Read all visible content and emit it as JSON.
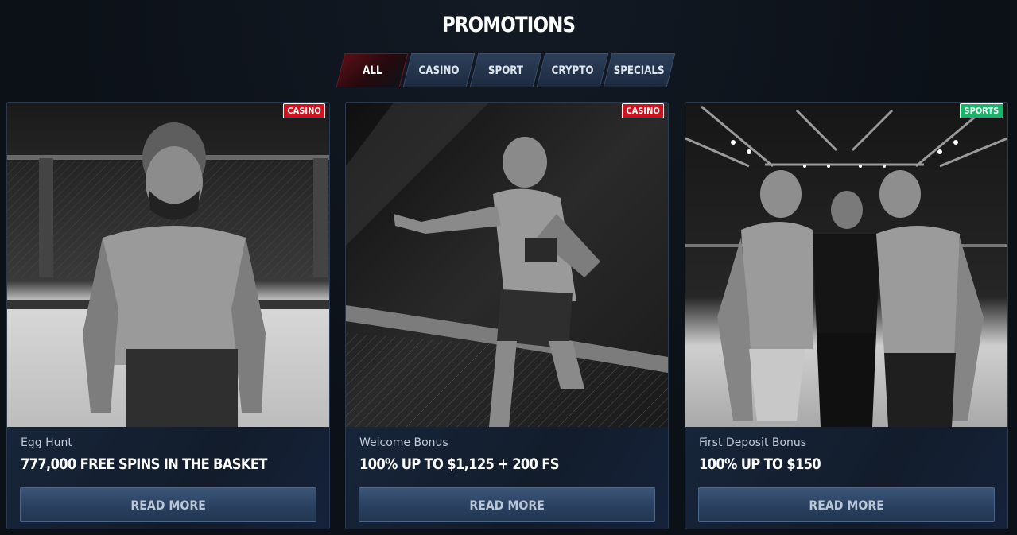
{
  "page": {
    "title": "PROMOTIONS"
  },
  "tabs": [
    {
      "label": "ALL",
      "active": true
    },
    {
      "label": "CASINO",
      "active": false
    },
    {
      "label": "SPORT",
      "active": false
    },
    {
      "label": "CRYPTO",
      "active": false
    },
    {
      "label": "SPECIALS",
      "active": false
    }
  ],
  "cards": [
    {
      "badge": "CASINO",
      "subtitle": "Egg Hunt",
      "title": "777,000 FREE SPINS IN THE BASKET",
      "button": "READ MORE"
    },
    {
      "badge": "CASINO",
      "subtitle": "Welcome Bonus",
      "title": "100% UP TO $1,125 + 200 FS",
      "button": "READ MORE"
    },
    {
      "badge": "SPORTS",
      "subtitle": "First Deposit Bonus",
      "title": "100% UP TO $150",
      "button": "READ MORE"
    }
  ],
  "colors": {
    "casino_badge": "#d1121d",
    "sports_badge": "#19b36a",
    "active_tab": "#5a0f18"
  }
}
